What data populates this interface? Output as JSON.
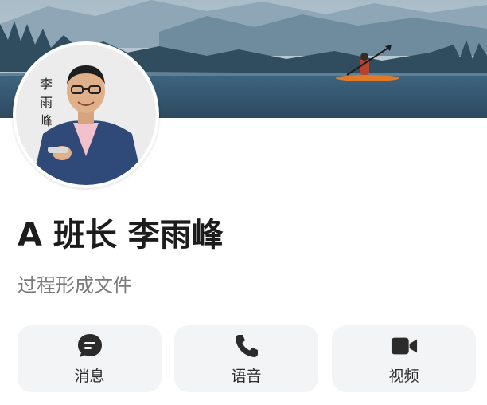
{
  "profile": {
    "name": "A 班长 李雨峰",
    "subtitle": "过程形成文件",
    "avatar_calligraphy": "李雨峰"
  },
  "actions": [
    {
      "label": "消息",
      "icon": "message-icon"
    },
    {
      "label": "语音",
      "icon": "phone-icon"
    },
    {
      "label": "视频",
      "icon": "video-camera-icon"
    }
  ],
  "colors": {
    "text_primary": "#1c1c1c",
    "text_secondary": "#7b7b7b",
    "button_bg": "#f3f4f6",
    "icon": "#2b2b2b"
  }
}
